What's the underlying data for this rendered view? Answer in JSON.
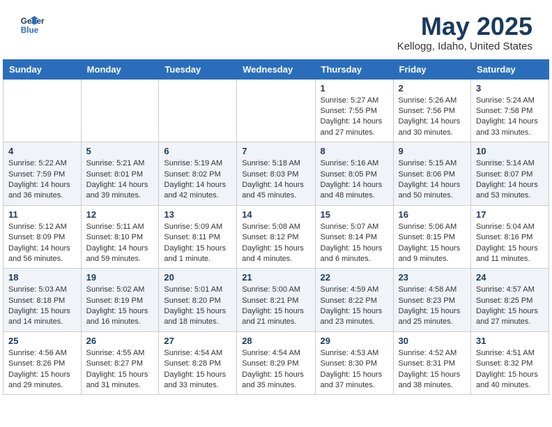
{
  "header": {
    "logo_line1": "General",
    "logo_line2": "Blue",
    "month": "May 2025",
    "location": "Kellogg, Idaho, United States"
  },
  "weekdays": [
    "Sunday",
    "Monday",
    "Tuesday",
    "Wednesday",
    "Thursday",
    "Friday",
    "Saturday"
  ],
  "weeks": [
    [
      {
        "day": "",
        "info": ""
      },
      {
        "day": "",
        "info": ""
      },
      {
        "day": "",
        "info": ""
      },
      {
        "day": "",
        "info": ""
      },
      {
        "day": "1",
        "info": "Sunrise: 5:27 AM\nSunset: 7:55 PM\nDaylight: 14 hours\nand 27 minutes."
      },
      {
        "day": "2",
        "info": "Sunrise: 5:26 AM\nSunset: 7:56 PM\nDaylight: 14 hours\nand 30 minutes."
      },
      {
        "day": "3",
        "info": "Sunrise: 5:24 AM\nSunset: 7:58 PM\nDaylight: 14 hours\nand 33 minutes."
      }
    ],
    [
      {
        "day": "4",
        "info": "Sunrise: 5:22 AM\nSunset: 7:59 PM\nDaylight: 14 hours\nand 36 minutes."
      },
      {
        "day": "5",
        "info": "Sunrise: 5:21 AM\nSunset: 8:01 PM\nDaylight: 14 hours\nand 39 minutes."
      },
      {
        "day": "6",
        "info": "Sunrise: 5:19 AM\nSunset: 8:02 PM\nDaylight: 14 hours\nand 42 minutes."
      },
      {
        "day": "7",
        "info": "Sunrise: 5:18 AM\nSunset: 8:03 PM\nDaylight: 14 hours\nand 45 minutes."
      },
      {
        "day": "8",
        "info": "Sunrise: 5:16 AM\nSunset: 8:05 PM\nDaylight: 14 hours\nand 48 minutes."
      },
      {
        "day": "9",
        "info": "Sunrise: 5:15 AM\nSunset: 8:06 PM\nDaylight: 14 hours\nand 50 minutes."
      },
      {
        "day": "10",
        "info": "Sunrise: 5:14 AM\nSunset: 8:07 PM\nDaylight: 14 hours\nand 53 minutes."
      }
    ],
    [
      {
        "day": "11",
        "info": "Sunrise: 5:12 AM\nSunset: 8:09 PM\nDaylight: 14 hours\nand 56 minutes."
      },
      {
        "day": "12",
        "info": "Sunrise: 5:11 AM\nSunset: 8:10 PM\nDaylight: 14 hours\nand 59 minutes."
      },
      {
        "day": "13",
        "info": "Sunrise: 5:09 AM\nSunset: 8:11 PM\nDaylight: 15 hours\nand 1 minute."
      },
      {
        "day": "14",
        "info": "Sunrise: 5:08 AM\nSunset: 8:12 PM\nDaylight: 15 hours\nand 4 minutes."
      },
      {
        "day": "15",
        "info": "Sunrise: 5:07 AM\nSunset: 8:14 PM\nDaylight: 15 hours\nand 6 minutes."
      },
      {
        "day": "16",
        "info": "Sunrise: 5:06 AM\nSunset: 8:15 PM\nDaylight: 15 hours\nand 9 minutes."
      },
      {
        "day": "17",
        "info": "Sunrise: 5:04 AM\nSunset: 8:16 PM\nDaylight: 15 hours\nand 11 minutes."
      }
    ],
    [
      {
        "day": "18",
        "info": "Sunrise: 5:03 AM\nSunset: 8:18 PM\nDaylight: 15 hours\nand 14 minutes."
      },
      {
        "day": "19",
        "info": "Sunrise: 5:02 AM\nSunset: 8:19 PM\nDaylight: 15 hours\nand 16 minutes."
      },
      {
        "day": "20",
        "info": "Sunrise: 5:01 AM\nSunset: 8:20 PM\nDaylight: 15 hours\nand 18 minutes."
      },
      {
        "day": "21",
        "info": "Sunrise: 5:00 AM\nSunset: 8:21 PM\nDaylight: 15 hours\nand 21 minutes."
      },
      {
        "day": "22",
        "info": "Sunrise: 4:59 AM\nSunset: 8:22 PM\nDaylight: 15 hours\nand 23 minutes."
      },
      {
        "day": "23",
        "info": "Sunrise: 4:58 AM\nSunset: 8:23 PM\nDaylight: 15 hours\nand 25 minutes."
      },
      {
        "day": "24",
        "info": "Sunrise: 4:57 AM\nSunset: 8:25 PM\nDaylight: 15 hours\nand 27 minutes."
      }
    ],
    [
      {
        "day": "25",
        "info": "Sunrise: 4:56 AM\nSunset: 8:26 PM\nDaylight: 15 hours\nand 29 minutes."
      },
      {
        "day": "26",
        "info": "Sunrise: 4:55 AM\nSunset: 8:27 PM\nDaylight: 15 hours\nand 31 minutes."
      },
      {
        "day": "27",
        "info": "Sunrise: 4:54 AM\nSunset: 8:28 PM\nDaylight: 15 hours\nand 33 minutes."
      },
      {
        "day": "28",
        "info": "Sunrise: 4:54 AM\nSunset: 8:29 PM\nDaylight: 15 hours\nand 35 minutes."
      },
      {
        "day": "29",
        "info": "Sunrise: 4:53 AM\nSunset: 8:30 PM\nDaylight: 15 hours\nand 37 minutes."
      },
      {
        "day": "30",
        "info": "Sunrise: 4:52 AM\nSunset: 8:31 PM\nDaylight: 15 hours\nand 38 minutes."
      },
      {
        "day": "31",
        "info": "Sunrise: 4:51 AM\nSunset: 8:32 PM\nDaylight: 15 hours\nand 40 minutes."
      }
    ]
  ]
}
